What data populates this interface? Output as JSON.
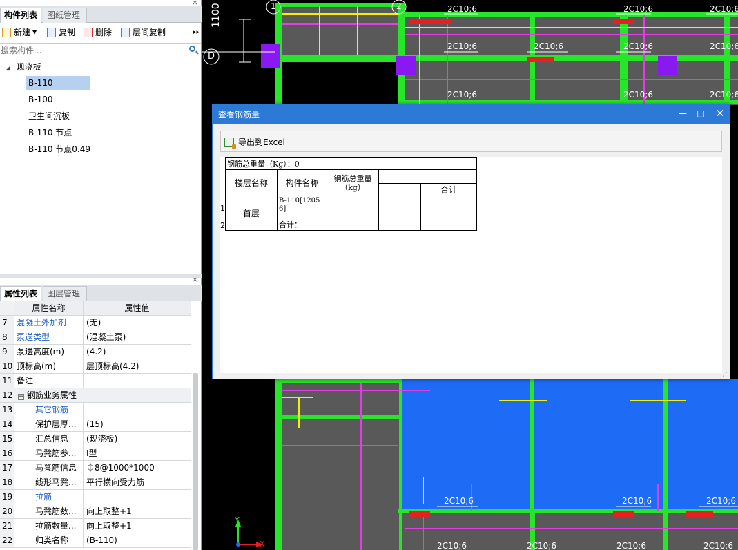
{
  "left_panel": {
    "tabs_top": [
      "构件列表",
      "图纸管理"
    ],
    "toolbar": {
      "new": "新建",
      "copy": "复制",
      "delete": "删除",
      "floor_copy": "层间复制"
    },
    "search": {
      "placeholder": "搜索构件..."
    },
    "tree": {
      "root": "现浇板",
      "items": [
        "B-110",
        "B-100",
        "卫生间沉板",
        "B-110 节点",
        "B-110 节点0.49"
      ]
    },
    "tabs_bottom": [
      "属性列表",
      "图层管理"
    ],
    "prop_headers": {
      "name": "属性名称",
      "value": "属性值"
    },
    "props": [
      {
        "num": "7",
        "name": "混凝土外加剂",
        "value": "(无)"
      },
      {
        "num": "8",
        "name": "泵送类型",
        "value": "(混凝土泵)"
      },
      {
        "num": "9",
        "name": "泵送高度(m)",
        "value": "(4.2)"
      },
      {
        "num": "10",
        "name": "顶标高(m)",
        "value": "层顶标高(4.2)"
      },
      {
        "num": "11",
        "name": "备注",
        "value": ""
      },
      {
        "num": "12",
        "name": "钢筋业务属性",
        "value": ""
      },
      {
        "num": "13",
        "name": "其它钢筋",
        "value": ""
      },
      {
        "num": "14",
        "name": "保护层厚...",
        "value": "(15)"
      },
      {
        "num": "15",
        "name": "汇总信息",
        "value": "(现浇板)"
      },
      {
        "num": "16",
        "name": "马凳筋参...",
        "value": "Ⅰ型"
      },
      {
        "num": "17",
        "name": "马凳筋信息",
        "value": "⏀8@1000*1000"
      },
      {
        "num": "18",
        "name": "线形马凳...",
        "value": "平行横向受力筋"
      },
      {
        "num": "19",
        "name": "拉筋",
        "value": ""
      },
      {
        "num": "20",
        "name": "马凳筋数...",
        "value": "向上取整+1"
      },
      {
        "num": "21",
        "name": "拉筋数量...",
        "value": "向上取整+1"
      },
      {
        "num": "22",
        "name": "归类名称",
        "value": "(B-110)"
      }
    ]
  },
  "cad": {
    "labels": {
      "grid1": "1",
      "grid2": "2",
      "gridD": "D",
      "dim1100": "1100",
      "rebar": "2C10;6",
      "rebar_partial": "2C10;6",
      "axis_y": "Y",
      "axis_x": "X"
    }
  },
  "dialog": {
    "title": "查看钢筋量",
    "export": "导出到Excel",
    "table": {
      "total": "钢筋总重量（Kg）：0",
      "h_floor": "楼层名称",
      "h_part": "构件名称",
      "h_weight": "钢筋总重量（kg）",
      "h_sum": "合计",
      "floor": "首层",
      "part": "B-110[12056]",
      "subtotal": "合计：",
      "row1": "1",
      "row2": "2"
    }
  },
  "colors": {
    "accent": "#2d7ad6",
    "cad_bg": "#000000",
    "beam": "#27e629",
    "slab": "#595959",
    "blue_area": "#1e6bf5",
    "magenta": "#e63ce6",
    "yellow": "#f2f200",
    "red": "#e62020"
  }
}
